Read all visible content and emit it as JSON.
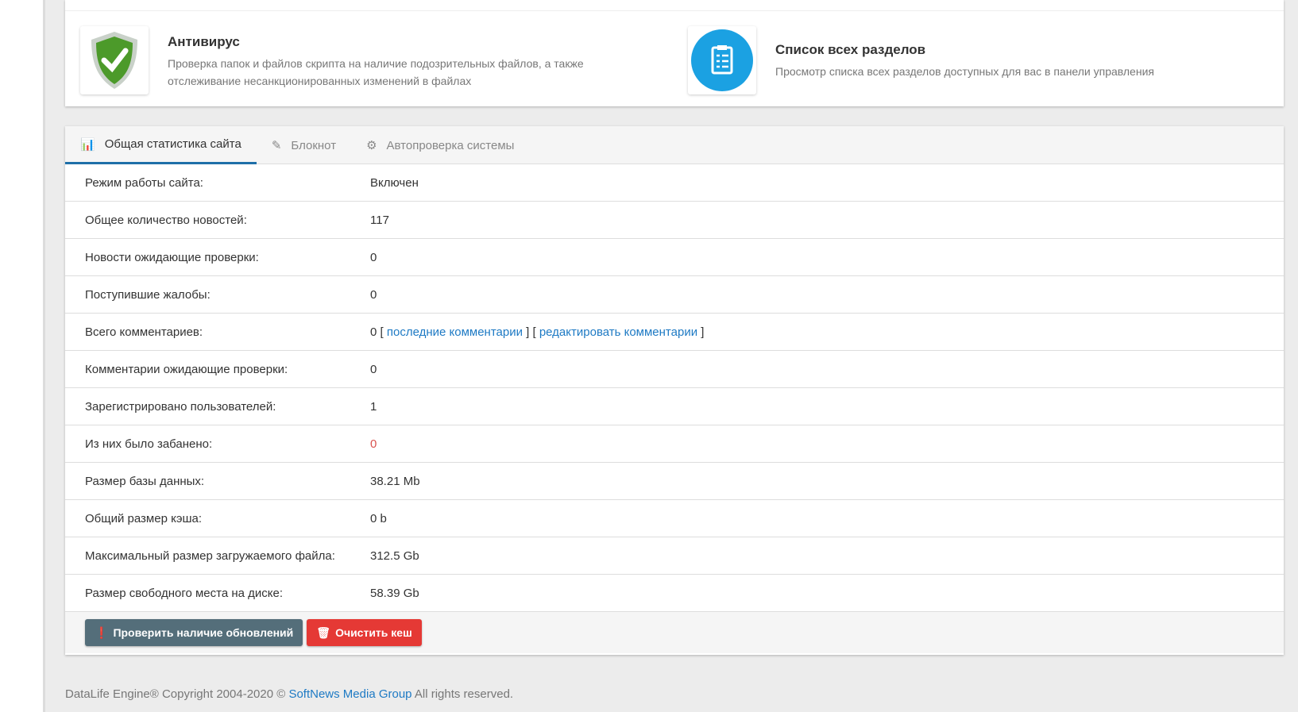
{
  "features": [
    {
      "title": "Антивирус",
      "desc1": "Проверка папок и файлов скрипта на наличие подозрительных файлов, а также",
      "desc2": "отслеживание несанкционированных изменений в файлах",
      "icon": "shield-check-icon"
    },
    {
      "title": "Список всех разделов",
      "desc1": "Просмотр списка всех разделов доступных для вас в панели управления",
      "icon": "clipboard-list-icon"
    }
  ],
  "tabs": [
    {
      "label": "Общая статистика сайта"
    },
    {
      "label": "Блокнот"
    },
    {
      "label": "Автопроверка системы"
    }
  ],
  "rows": [
    {
      "k": "Режим работы сайта:",
      "v": "Включен"
    },
    {
      "k": "Общее количество новостей:",
      "v": "117"
    },
    {
      "k": "Новости ожидающие проверки:",
      "v": "0"
    },
    {
      "k": "Поступившие жалобы:",
      "v": "0"
    },
    {
      "k": "Всего комментариев:",
      "v": "0",
      "b1": " [ ",
      "l1": "последние комментарии",
      "b2": " ] [ ",
      "l2": "редактировать комментарии",
      "b3": " ]"
    },
    {
      "k": "Комментарии ожидающие проверки:",
      "v": "0"
    },
    {
      "k": "Зарегистрировано пользователей:",
      "v": "1"
    },
    {
      "k": "Из них было забанено:",
      "v": "0"
    },
    {
      "k": "Размер базы данных:",
      "v": "38.21 Mb"
    },
    {
      "k": "Общий размер кэша:",
      "v": "0 b"
    },
    {
      "k": "Максимальный размер загружаемого файла:",
      "v": "312.5 Gb"
    },
    {
      "k": "Размер свободного места на диске:",
      "v": "58.39 Gb"
    }
  ],
  "buttons": {
    "check_updates": "Проверить наличие обновлений",
    "clear_cache": "Очистить кеш"
  },
  "footer": {
    "prefix": "DataLife Engine® Copyright 2004-2020 © ",
    "link": "SoftNews Media Group",
    "suffix": " All rights reserved."
  },
  "colors": {
    "accent": "#1e6fa8",
    "link": "#1e7ac4",
    "danger": "#e53935",
    "dark_button": "#546e7a"
  }
}
